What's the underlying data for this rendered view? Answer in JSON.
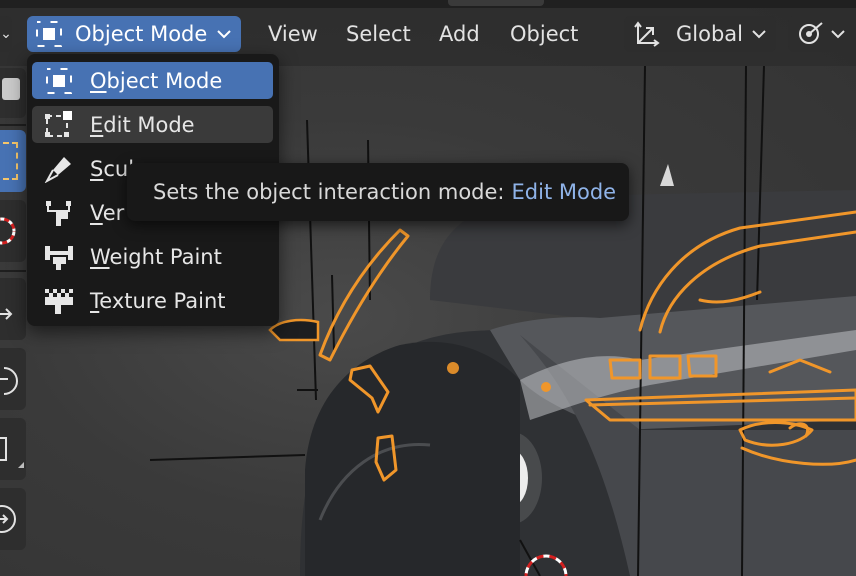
{
  "header": {
    "mode_selector": {
      "label": "Object Mode",
      "icon": "object-mode-icon"
    },
    "menus": [
      {
        "label": "View"
      },
      {
        "label": "Select"
      },
      {
        "label": "Add"
      },
      {
        "label": "Object"
      }
    ],
    "orientation": {
      "label": "Global",
      "icon": "transform-orientation-icon"
    },
    "snap": {
      "icon": "snap-icon"
    }
  },
  "mode_menu": {
    "items": [
      {
        "label": "Object Mode",
        "mnemonic": "O",
        "rest": "bject Mode",
        "icon": "object-mode-icon",
        "state": "selected"
      },
      {
        "label": "Edit Mode",
        "mnemonic": "E",
        "rest": "dit Mode",
        "icon": "edit-mode-icon",
        "state": "hover"
      },
      {
        "label": "Sculpt Mode",
        "mnemonic": "S",
        "rest": "cul",
        "icon": "sculpt-mode-icon",
        "state": "normal"
      },
      {
        "label": "Vertex Paint",
        "mnemonic": "V",
        "rest": "er",
        "icon": "vertex-paint-icon",
        "state": "normal"
      },
      {
        "label": "Weight Paint",
        "mnemonic": "W",
        "rest": "eight Paint",
        "icon": "weight-paint-icon",
        "state": "normal"
      },
      {
        "label": "Texture Paint",
        "mnemonic": "T",
        "rest": "exture Paint",
        "icon": "texture-paint-icon",
        "state": "normal"
      }
    ]
  },
  "tooltip": {
    "text": "Sets the object interaction mode:",
    "value": "Edit Mode"
  },
  "colors": {
    "accent": "#4772b3",
    "tooltip_value": "#8fb3e8",
    "selection_outline": "#f0962a",
    "menu_bg": "#191919"
  }
}
